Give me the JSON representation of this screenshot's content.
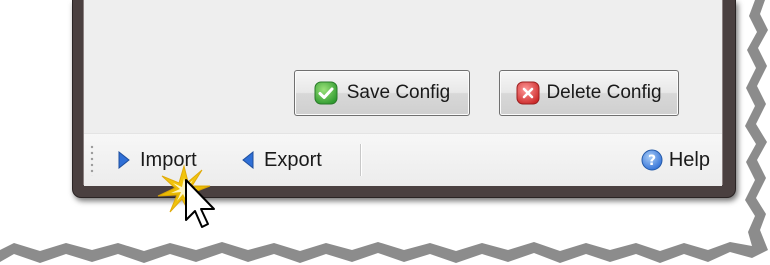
{
  "buttons": {
    "save_config": "Save Config",
    "delete_config": "Delete Config"
  },
  "toolbar": {
    "import_label": "Import",
    "export_label": "Export",
    "help_label": "Help"
  },
  "icons": {
    "save": "green-check-icon",
    "delete": "red-x-icon",
    "import": "blue-arrow-right-icon",
    "export": "blue-arrow-left-icon",
    "help": "help-question-icon",
    "cursor": "mouse-pointer-icon",
    "click_effect": "click-burst-icon"
  },
  "colors": {
    "accent_blue": "#2f6fd6",
    "success_green": "#3aa83a",
    "danger_red": "#d83a3a",
    "burst_yellow": "#f2c200"
  }
}
